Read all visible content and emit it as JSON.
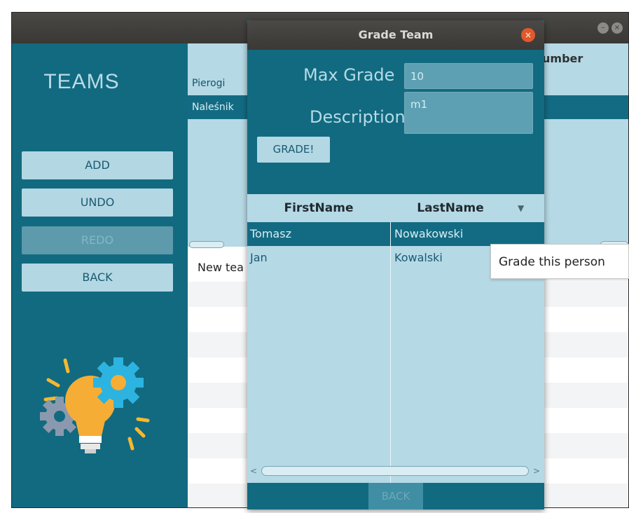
{
  "main_window": {
    "sidebar": {
      "title": "TEAMS",
      "buttons": [
        {
          "label": "ADD",
          "enabled": true
        },
        {
          "label": "UNDO",
          "enabled": true
        },
        {
          "label": "REDO",
          "enabled": false
        },
        {
          "label": "BACK",
          "enabled": true
        }
      ]
    },
    "teams_table": {
      "header_partial": "umber",
      "rows": [
        "Pierogi",
        "Naleśnik"
      ],
      "selected_index": 1
    },
    "lower_table": {
      "first_row": "New tea"
    }
  },
  "dialog": {
    "title": "Grade Team",
    "close_icon": "close-icon",
    "max_grade_label": "Max Grade",
    "max_grade_value": "10",
    "description_label": "Description",
    "description_value": "m1",
    "grade_button": "GRADE!",
    "table": {
      "columns": [
        "FirstName",
        "LastName"
      ],
      "sort_icon": "sort-down-icon",
      "rows": [
        {
          "first": "Tomasz",
          "last": "Nowakowski",
          "selected": true
        },
        {
          "first": "Jan",
          "last": "Kowalski",
          "selected": false
        }
      ]
    },
    "back_button": "BACK"
  },
  "tooltip": "Grade this person",
  "colors": {
    "primary": "#126a80",
    "light": "#b5d9e5",
    "button": "#b3d8e3",
    "close": "#e3582a"
  }
}
